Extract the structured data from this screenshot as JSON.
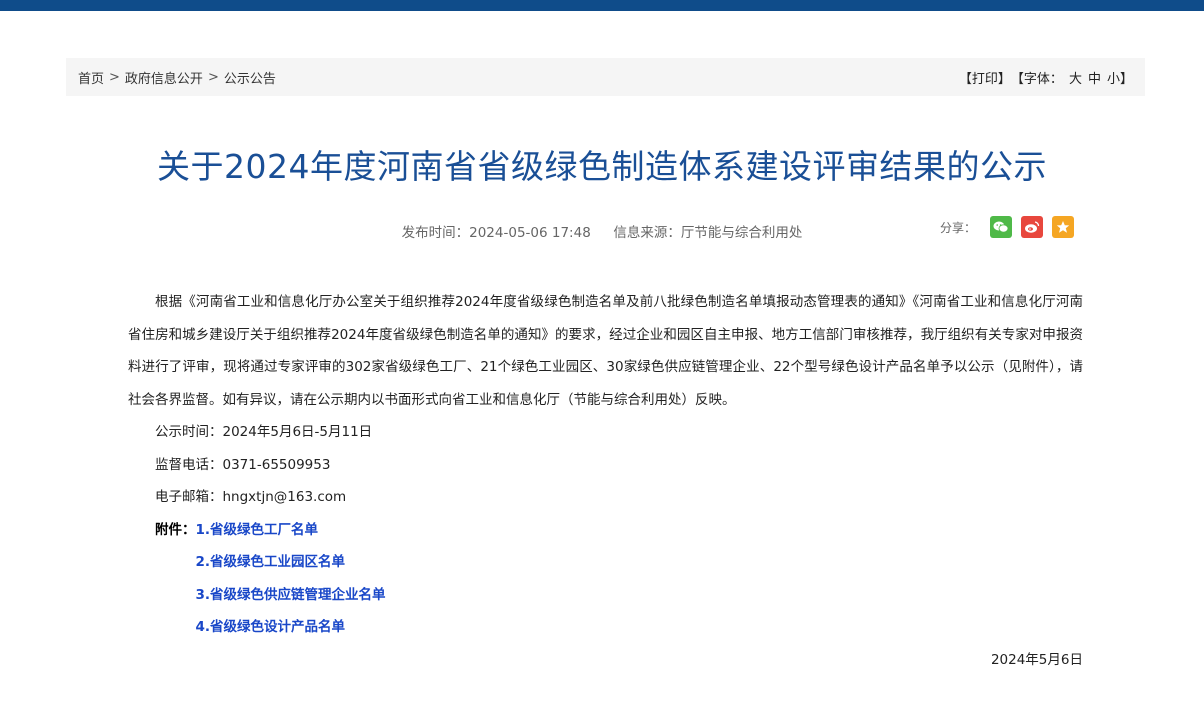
{
  "breadcrumb": {
    "home": "首页",
    "level1": "政府信息公开",
    "level2": "公示公告",
    "separator": ">"
  },
  "tools": {
    "print": "【打印】",
    "font_prefix": "【字体：",
    "size_large": "大",
    "size_medium": "中",
    "size_small": "小",
    "font_suffix": "】"
  },
  "article": {
    "title": "关于2024年度河南省省级绿色制造体系建设评审结果的公示",
    "publish_label": "发布时间：",
    "publish_time": "2024-05-06 17:48",
    "source_label": "信息来源：",
    "source": "厅节能与综合利用处",
    "paragraph": "根据《河南省工业和信息化厅办公室关于组织推荐2024年度省级绿色制造名单及前八批绿色制造名单填报动态管理表的通知》《河南省工业和信息化厅河南省住房和城乡建设厅关于组织推荐2024年度省级绿色制造名单的通知》的要求，经过企业和园区自主申报、地方工信部门审核推荐，我厅组织有关专家对申报资料进行了评审，现将通过专家评审的302家省级绿色工厂、21个绿色工业园区、30家绿色供应链管理企业、22个型号绿色设计产品名单予以公示（见附件），请社会各界监督。如有异议，请在公示期内以书面形式向省工业和信息化厅（节能与综合利用处）反映。",
    "period": "公示时间：2024年5月6日-5月11日",
    "phone": "监督电话：0371-65509953",
    "email": "电子邮箱：hngxtjn@163.com",
    "attachments_label": "附件：",
    "attachments": [
      "1.省级绿色工厂名单",
      "2.省级绿色工业园区名单",
      "3.省级绿色供应链管理企业名单",
      "4.省级绿色设计产品名单"
    ],
    "date": "2024年5月6日"
  },
  "share": {
    "label": "分享：",
    "icons": [
      "wechat-icon",
      "weibo-icon",
      "favorite-icon"
    ]
  },
  "colors": {
    "top_bar": "#0f4c8a",
    "title": "#1a4f96",
    "link": "#1947c8",
    "wechat": "#4fb948",
    "weibo": "#e8473d",
    "favorite": "#f5a623"
  }
}
